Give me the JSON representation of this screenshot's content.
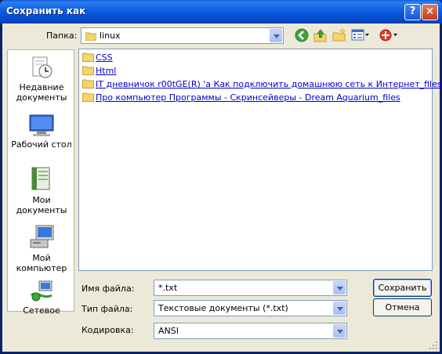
{
  "window": {
    "title": "Сохранить как",
    "help_label": "?",
    "close_label": "×"
  },
  "toolbar": {
    "folder_label": "Папка:",
    "folder_value": "linux",
    "icons": [
      "back-icon",
      "up-folder-icon",
      "new-folder-icon",
      "view-menu-icon",
      "tools-menu-icon"
    ]
  },
  "places": [
    {
      "label": "Недавние документы",
      "icon": "recent-documents-icon"
    },
    {
      "label": "Рабочий стол",
      "icon": "desktop-icon"
    },
    {
      "label": "Мои документы",
      "icon": "my-documents-icon"
    },
    {
      "label": "Мой компьютер",
      "icon": "my-computer-icon"
    },
    {
      "label": "Сетевое",
      "icon": "network-icon"
    }
  ],
  "files": [
    {
      "name": "CSS"
    },
    {
      "name": "Html"
    },
    {
      "name": "IT дневничок r00tGE(R) 'а Как подключить домашнюю сеть к Интернет_files"
    },
    {
      "name": "Про компьютер Программы - Скринсейверы - Dream Aquarium_files"
    }
  ],
  "form": {
    "filename_label": "Имя файла:",
    "filename_value": "*.txt",
    "filetype_label": "Тип файла:",
    "filetype_value": "Текстовые документы (*.txt)",
    "encoding_label": "Кодировка:",
    "encoding_value": "ANSI"
  },
  "buttons": {
    "save": "Сохранить",
    "cancel": "Отмена"
  }
}
